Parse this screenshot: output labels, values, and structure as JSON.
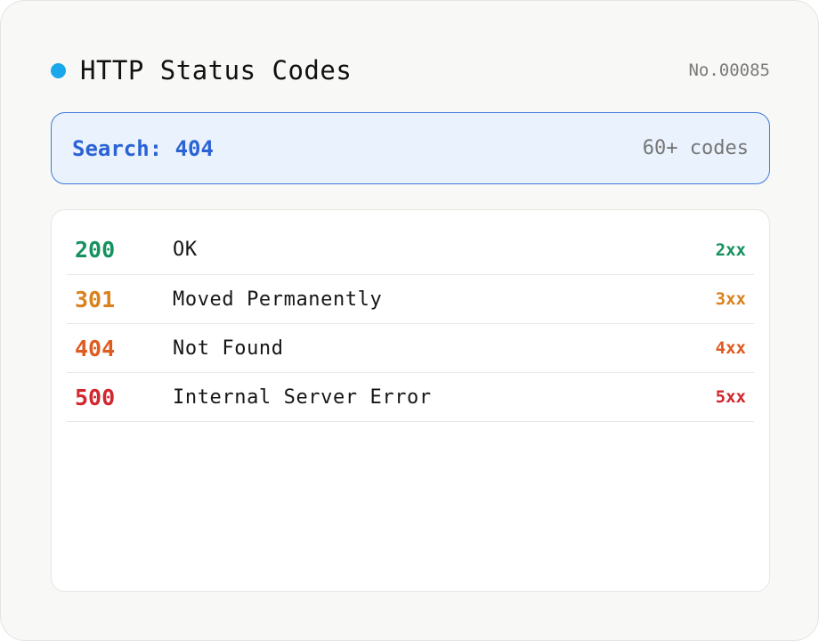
{
  "header": {
    "title": "HTTP Status Codes",
    "serial": "No.00085",
    "dot_color": "#1aa7ec"
  },
  "search": {
    "label": "Search: 404",
    "count": "60+ codes"
  },
  "rows": [
    {
      "code": "200",
      "description": "OK",
      "class": "2xx",
      "color": "#15925e"
    },
    {
      "code": "301",
      "description": "Moved Permanently",
      "class": "3xx",
      "color": "#d9821c"
    },
    {
      "code": "404",
      "description": "Not Found",
      "class": "4xx",
      "color": "#e05b1f"
    },
    {
      "code": "500",
      "description": "Internal Server Error",
      "class": "5xx",
      "color": "#d2272e"
    }
  ]
}
